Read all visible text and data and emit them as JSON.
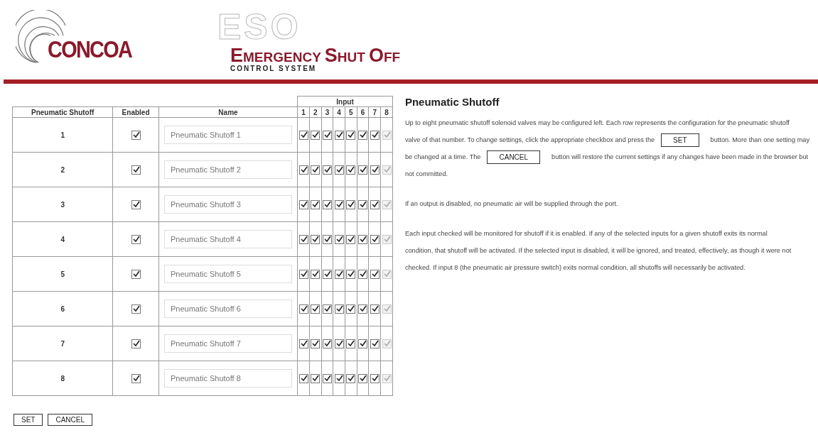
{
  "header": {
    "brand": "CONCOA",
    "watermark": "ESO",
    "title": "EMERGENCY SHUT OFF",
    "subtitle": "CONTROL SYSTEM"
  },
  "table": {
    "input_group": "Input",
    "columns": [
      "Pneumatic Shutoff",
      "Enabled",
      "Name"
    ],
    "input_columns": [
      "1",
      "2",
      "3",
      "4",
      "5",
      "6",
      "7",
      "8"
    ],
    "rows": [
      {
        "number": "1",
        "enabled": true,
        "name": "Pneumatic Shutoff 1",
        "inputs": [
          {
            "checked": true,
            "disabled": false
          },
          {
            "checked": true,
            "disabled": false
          },
          {
            "checked": true,
            "disabled": false
          },
          {
            "checked": true,
            "disabled": false
          },
          {
            "checked": true,
            "disabled": false
          },
          {
            "checked": true,
            "disabled": false
          },
          {
            "checked": true,
            "disabled": false
          },
          {
            "checked": true,
            "disabled": true
          }
        ]
      },
      {
        "number": "2",
        "enabled": true,
        "name": "Pneumatic Shutoff 2",
        "inputs": [
          {
            "checked": true,
            "disabled": false
          },
          {
            "checked": true,
            "disabled": false
          },
          {
            "checked": true,
            "disabled": false
          },
          {
            "checked": true,
            "disabled": false
          },
          {
            "checked": true,
            "disabled": false
          },
          {
            "checked": true,
            "disabled": false
          },
          {
            "checked": true,
            "disabled": false
          },
          {
            "checked": true,
            "disabled": true
          }
        ]
      },
      {
        "number": "3",
        "enabled": true,
        "name": "Pneumatic Shutoff 3",
        "inputs": [
          {
            "checked": true,
            "disabled": false
          },
          {
            "checked": true,
            "disabled": false
          },
          {
            "checked": true,
            "disabled": false
          },
          {
            "checked": true,
            "disabled": false
          },
          {
            "checked": true,
            "disabled": false
          },
          {
            "checked": true,
            "disabled": false
          },
          {
            "checked": true,
            "disabled": false
          },
          {
            "checked": true,
            "disabled": true
          }
        ]
      },
      {
        "number": "4",
        "enabled": true,
        "name": "Pneumatic Shutoff 4",
        "inputs": [
          {
            "checked": true,
            "disabled": false
          },
          {
            "checked": true,
            "disabled": false
          },
          {
            "checked": true,
            "disabled": false
          },
          {
            "checked": true,
            "disabled": false
          },
          {
            "checked": true,
            "disabled": false
          },
          {
            "checked": true,
            "disabled": false
          },
          {
            "checked": true,
            "disabled": false
          },
          {
            "checked": true,
            "disabled": true
          }
        ]
      },
      {
        "number": "5",
        "enabled": true,
        "name": "Pneumatic Shutoff 5",
        "inputs": [
          {
            "checked": true,
            "disabled": false
          },
          {
            "checked": true,
            "disabled": false
          },
          {
            "checked": true,
            "disabled": false
          },
          {
            "checked": true,
            "disabled": false
          },
          {
            "checked": true,
            "disabled": false
          },
          {
            "checked": true,
            "disabled": false
          },
          {
            "checked": true,
            "disabled": false
          },
          {
            "checked": true,
            "disabled": true
          }
        ]
      },
      {
        "number": "6",
        "enabled": true,
        "name": "Pneumatic Shutoff 6",
        "inputs": [
          {
            "checked": true,
            "disabled": false
          },
          {
            "checked": true,
            "disabled": false
          },
          {
            "checked": true,
            "disabled": false
          },
          {
            "checked": true,
            "disabled": false
          },
          {
            "checked": true,
            "disabled": false
          },
          {
            "checked": true,
            "disabled": false
          },
          {
            "checked": true,
            "disabled": false
          },
          {
            "checked": true,
            "disabled": true
          }
        ]
      },
      {
        "number": "7",
        "enabled": true,
        "name": "Pneumatic Shutoff 7",
        "inputs": [
          {
            "checked": true,
            "disabled": false
          },
          {
            "checked": true,
            "disabled": false
          },
          {
            "checked": true,
            "disabled": false
          },
          {
            "checked": true,
            "disabled": false
          },
          {
            "checked": true,
            "disabled": false
          },
          {
            "checked": true,
            "disabled": false
          },
          {
            "checked": true,
            "disabled": false
          },
          {
            "checked": true,
            "disabled": true
          }
        ]
      },
      {
        "number": "8",
        "enabled": true,
        "name": "Pneumatic Shutoff 8",
        "inputs": [
          {
            "checked": true,
            "disabled": false
          },
          {
            "checked": true,
            "disabled": false
          },
          {
            "checked": true,
            "disabled": false
          },
          {
            "checked": true,
            "disabled": false
          },
          {
            "checked": true,
            "disabled": false
          },
          {
            "checked": true,
            "disabled": false
          },
          {
            "checked": true,
            "disabled": false
          },
          {
            "checked": true,
            "disabled": true
          }
        ]
      }
    ]
  },
  "buttons": [
    "SET",
    "CANCEL"
  ],
  "help": {
    "title": "Pneumatic Shutoff",
    "paragraphs": [
      [
        [
          {
            "kind": "text",
            "text": "Up to eight pneumatic shutoff solenoid valves may be configured left. Each row represents the configuration for the pneumatic shutoff"
          }
        ],
        [
          {
            "kind": "text",
            "text": "valve of that number. To change settings, click the appropriate checkbox and press the"
          },
          {
            "kind": "button",
            "text": "SET"
          },
          {
            "kind": "text",
            "text": "button. More than one setting may"
          }
        ],
        [
          {
            "kind": "text",
            "text": "be changed at a time. The"
          },
          {
            "kind": "button",
            "text": "CANCEL"
          },
          {
            "kind": "text",
            "text": "button will restore the current settings if any changes have been made in the browser but"
          }
        ],
        [
          {
            "kind": "text",
            "text": "not committed."
          }
        ]
      ],
      [
        [
          {
            "kind": "text",
            "text": "If an output is disabled, no pneumatic air will be supplied through the port."
          }
        ]
      ],
      [
        [
          {
            "kind": "text",
            "text": "Each input checked will be monitored for shutoff if it is enabled. If any of the selected inputs for a given shutoff exits its normal"
          }
        ],
        [
          {
            "kind": "text",
            "text": "condition, that shutoff will be activated. If the selected input is disabled, it will be ignored, and treated, effectively, as though it were not"
          }
        ],
        [
          {
            "kind": "text",
            "text": "checked. If input 8 (the pneumatic air pressure switch) exits normal condition, all shutoffs will necessarily be activated."
          }
        ]
      ]
    ]
  }
}
